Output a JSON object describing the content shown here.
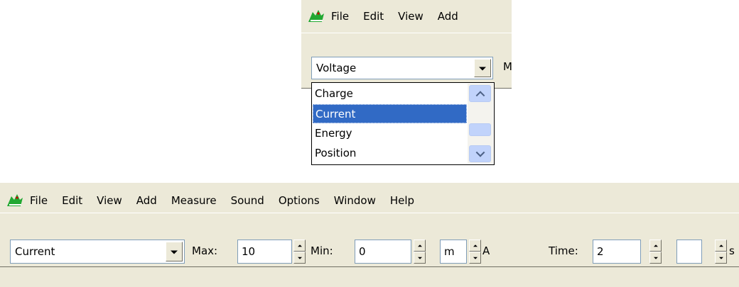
{
  "top_window": {
    "menu": [
      "File",
      "Edit",
      "View",
      "Add"
    ],
    "quantity_combo": {
      "value": "Voltage"
    },
    "truncated_label": "M",
    "dropdown": {
      "options": [
        "Charge",
        "Current",
        "Energy",
        "Position"
      ],
      "selected": "Current"
    }
  },
  "bottom_window": {
    "menu": [
      "File",
      "Edit",
      "View",
      "Add",
      "Measure",
      "Sound",
      "Options",
      "Window",
      "Help"
    ],
    "quantity_combo": {
      "value": "Current"
    },
    "max": {
      "label": "Max:",
      "value": "10"
    },
    "min": {
      "label": "Min:",
      "value": "0"
    },
    "prefix": {
      "value": "m"
    },
    "unit": "A",
    "time": {
      "label": "Time:",
      "value": "2"
    },
    "time_prefix": {
      "value": ""
    },
    "time_unit": "s"
  },
  "icons": {
    "app_logo": "crocodile-icon"
  },
  "colors": {
    "panel": "#ece9d8",
    "selection": "#316ac5",
    "logo": "#22a832"
  }
}
